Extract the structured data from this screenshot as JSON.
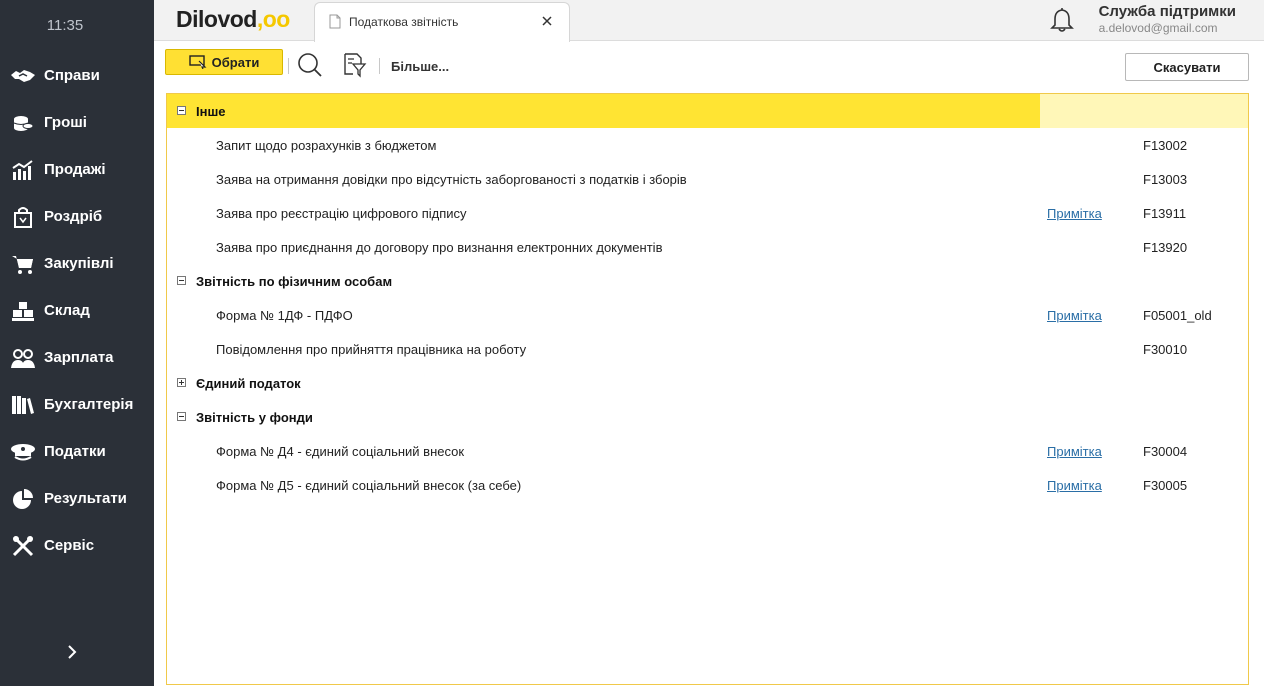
{
  "sidebar": {
    "time": "11:35",
    "items": [
      {
        "label": "Справи",
        "icon": "handshake-icon"
      },
      {
        "label": "Гроші",
        "icon": "coins-icon"
      },
      {
        "label": "Продажі",
        "icon": "sales-chart-icon"
      },
      {
        "label": "Роздріб",
        "icon": "shopping-bag-icon"
      },
      {
        "label": "Закупівлі",
        "icon": "cart-icon"
      },
      {
        "label": "Склад",
        "icon": "boxes-icon"
      },
      {
        "label": "Зарплата",
        "icon": "people-icon"
      },
      {
        "label": "Бухгалтерія",
        "icon": "books-icon"
      },
      {
        "label": "Податки",
        "icon": "officer-cap-icon"
      },
      {
        "label": "Результати",
        "icon": "pie-chart-icon"
      },
      {
        "label": "Сервіс",
        "icon": "tools-icon"
      }
    ]
  },
  "header": {
    "logo_main": "Dilovod",
    "logo_accent": ",oo",
    "tab_title": "Податкова звітність",
    "support_title": "Служба підтримки",
    "support_email": "a.delovod@gmail.com"
  },
  "toolbar": {
    "select_label": "Обрати",
    "more_label": "Більше...",
    "cancel_label": "Скасувати"
  },
  "list": {
    "groups": [
      {
        "title": "Інше",
        "expanded": true,
        "active": true,
        "items": [
          {
            "name": "Запит щодо розрахунків з бюджетом",
            "note": "",
            "code": "F13002"
          },
          {
            "name": "Заява на отримання довідки про відсутність заборгованості з податків і зборів",
            "note": "",
            "code": "F13003"
          },
          {
            "name": "Заява про реєстрацію цифрового підпису",
            "note": "Примітка",
            "code": "F13911"
          },
          {
            "name": "Заява про приєднання до договору про визнання електронних документів",
            "note": "",
            "code": "F13920"
          }
        ]
      },
      {
        "title": "Звітність по фізичним особам",
        "expanded": true,
        "active": false,
        "items": [
          {
            "name": "Форма № 1ДФ - ПДФО",
            "note": "Примітка",
            "code": "F05001_old"
          },
          {
            "name": "Повідомлення про прийняття працівника на роботу",
            "note": "",
            "code": "F30010"
          }
        ]
      },
      {
        "title": "Єдиний податок",
        "expanded": false,
        "active": false,
        "items": []
      },
      {
        "title": "Звітність у фонди",
        "expanded": true,
        "active": false,
        "items": [
          {
            "name": "Форма № Д4 - єдиний соціальний внесок",
            "note": "Примітка",
            "code": "F30004"
          },
          {
            "name": "Форма № Д5 - єдиний соціальний внесок (за себе)",
            "note": "Примітка",
            "code": "F30005"
          }
        ]
      }
    ]
  },
  "colors": {
    "sidebar_bg": "#2b3038",
    "accent_yellow": "#ffe433",
    "link_blue": "#2a6ea6"
  }
}
